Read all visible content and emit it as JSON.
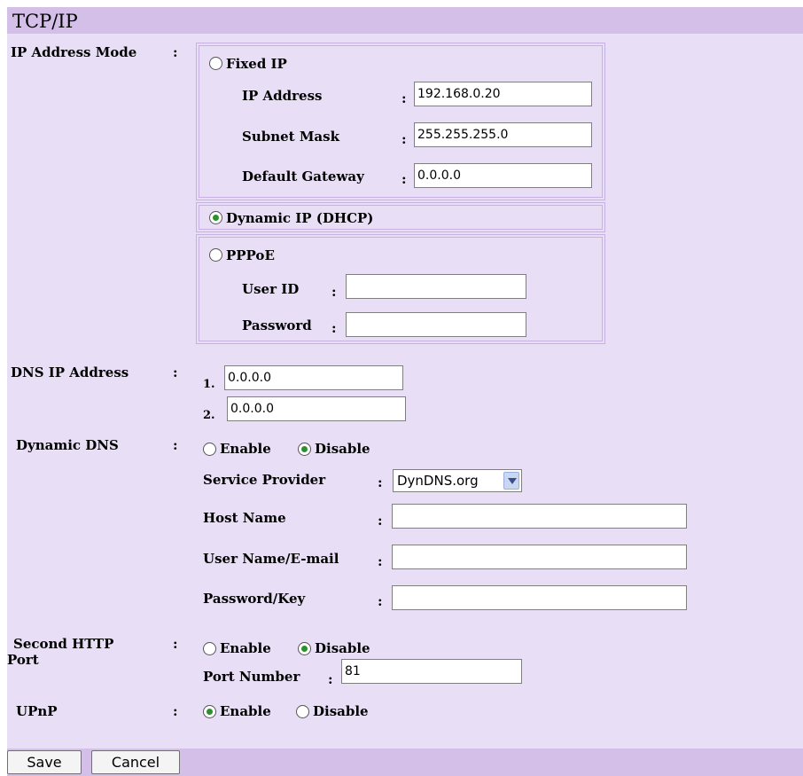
{
  "header": {
    "title": "TCP/IP"
  },
  "ip_mode": {
    "label": "IP Address Mode",
    "colon": ":",
    "fixed": {
      "label": "Fixed IP",
      "selected": false,
      "ip_address_label": "IP Address",
      "ip_address_value": "192.168.0.20",
      "subnet_mask_label": "Subnet Mask",
      "subnet_mask_value": "255.255.255.0",
      "gateway_label": "Default Gateway",
      "gateway_value": "0.0.0.0"
    },
    "dhcp": {
      "label": "Dynamic IP (DHCP)",
      "selected": true
    },
    "pppoe": {
      "label": "PPPoE",
      "selected": false,
      "user_id_label": "User ID",
      "user_id_value": "",
      "password_label": "Password",
      "password_value": ""
    }
  },
  "dns": {
    "label": "DNS IP Address",
    "colon": ":",
    "num1": "1.",
    "value1": "0.0.0.0",
    "num2": "2.",
    "value2": "0.0.0.0"
  },
  "ddns": {
    "label": "Dynamic DNS",
    "colon": ":",
    "enable_label": "Enable",
    "disable_label": "Disable",
    "selected": "Disable",
    "provider_label": "Service Provider",
    "provider_value": "DynDNS.org",
    "host_label": "Host Name",
    "host_value": "",
    "user_label": "User Name/E-mail",
    "user_value": "",
    "key_label": "Password/Key",
    "key_value": ""
  },
  "http2": {
    "label_line1": "Second HTTP",
    "label_line2": "Port",
    "colon": ":",
    "enable_label": "Enable",
    "disable_label": "Disable",
    "selected": "Disable",
    "port_label": "Port Number",
    "port_value": "81"
  },
  "upnp": {
    "label": "UPnP",
    "colon": ":",
    "enable_label": "Enable",
    "disable_label": "Disable",
    "selected": "Enable"
  },
  "footer": {
    "save_label": "Save",
    "cancel_label": "Cancel"
  },
  "colors": {
    "header_bg": "#d4bfe8",
    "content_bg": "#e8def5",
    "radio_dot": "#2d8f2d"
  },
  "icons": {
    "radio": "radio-icon",
    "dropdown": "chevron-down-icon"
  }
}
